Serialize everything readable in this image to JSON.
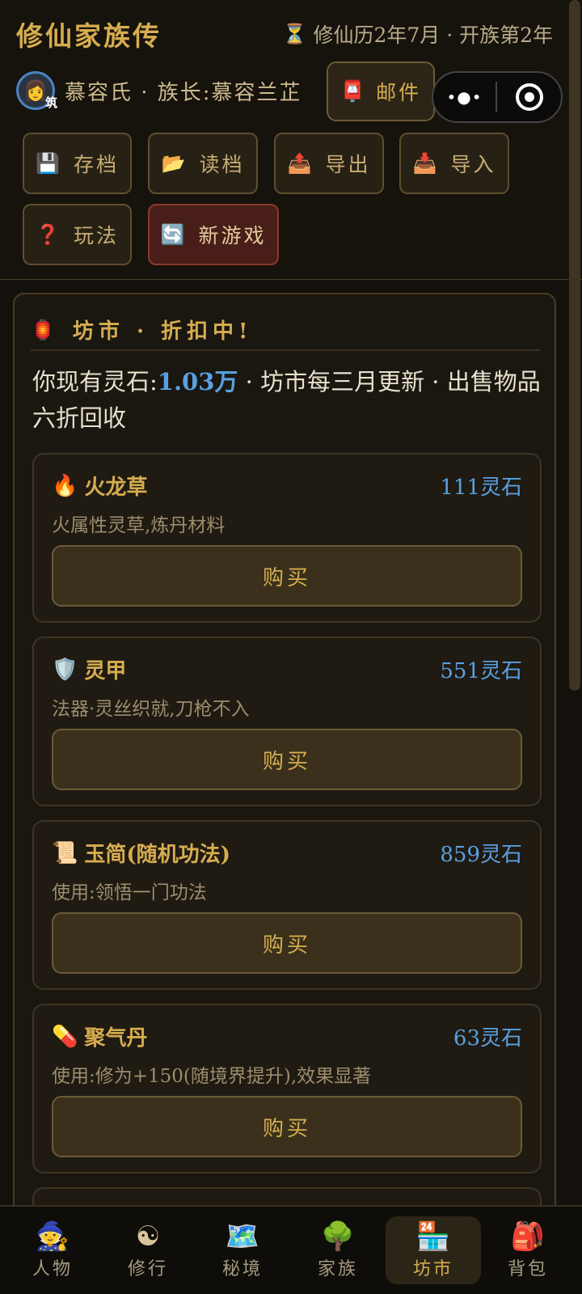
{
  "header": {
    "title": "修仙家族传",
    "calendar_icon": "hourglass-icon",
    "calendar": "修仙历2年7月 · 开族第2年"
  },
  "clan": {
    "avatar_tag": "筑",
    "name": "慕容氏 · 族长:慕容兰芷",
    "mail_label": "邮件"
  },
  "toolbar": {
    "save_label": "存档",
    "load_label": "读档",
    "export_label": "导出",
    "import_label": "导入",
    "help_label": "玩法",
    "newgame_label": "新游戏"
  },
  "market": {
    "title": "坊市 · 折扣中!",
    "info_prefix": "你现有灵石:",
    "spirit_stones": "1.03万",
    "info_suffix": " · 坊市每三月更新 · 出售物品六折回收",
    "items": [
      {
        "icon": "fire-icon",
        "name": "火龙草",
        "price": "111灵石",
        "desc": "火属性灵草,炼丹材料",
        "buy_label": "购买"
      },
      {
        "icon": "shield-icon",
        "name": "灵甲",
        "price": "551灵石",
        "desc": "法器·灵丝织就,刀枪不入",
        "buy_label": "购买"
      },
      {
        "icon": "scroll-icon",
        "name": "玉简(随机功法)",
        "price": "859灵石",
        "desc": "使用:领悟一门功法",
        "buy_label": "购买"
      },
      {
        "icon": "pill-icon",
        "name": "聚气丹",
        "price": "63灵石",
        "desc": "使用:修为+150(随境界提升),效果显著",
        "buy_label": "购买"
      }
    ]
  },
  "nav": {
    "items": [
      {
        "label": "人物",
        "icon": "character-icon"
      },
      {
        "label": "修行",
        "icon": "yin-yang-icon"
      },
      {
        "label": "秘境",
        "icon": "map-icon"
      },
      {
        "label": "家族",
        "icon": "tree-icon"
      },
      {
        "label": "坊市",
        "icon": "shop-icon",
        "active": true
      },
      {
        "label": "背包",
        "icon": "backpack-icon"
      }
    ]
  },
  "colors": {
    "accent_gold": "#d6ad4f",
    "price_blue": "#59a0e0",
    "danger_red": "#4a1e18"
  }
}
